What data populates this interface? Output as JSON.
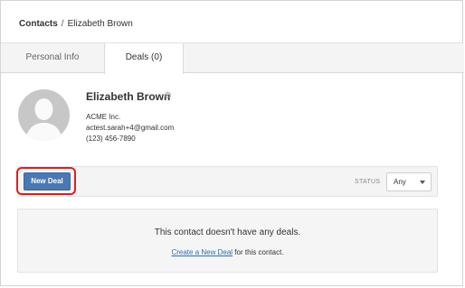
{
  "breadcrumb": {
    "root": "Contacts",
    "separator": "/",
    "current": "Elizabeth Brown"
  },
  "tabs": [
    {
      "label": "Personal Info",
      "active": false
    },
    {
      "label": "Deals (0)",
      "active": true
    }
  ],
  "contact": {
    "name": "Elizabeth Brown",
    "company": "ACME Inc.",
    "email": "actest.sarah+4@gmail.com",
    "phone": "(123) 456-7890",
    "avatar_icon": "user-silhouette-icon",
    "settings_icon": "gear-icon"
  },
  "deals_toolbar": {
    "new_deal_label": "New Deal",
    "status_label": "STATUS",
    "status_value": "Any",
    "highlight_color": "#e11d1d",
    "button_color": "#4a78b3"
  },
  "empty_state": {
    "message": "This contact doesn't have any deals.",
    "link_text": "Create a New Deal",
    "suffix": " for this contact."
  }
}
